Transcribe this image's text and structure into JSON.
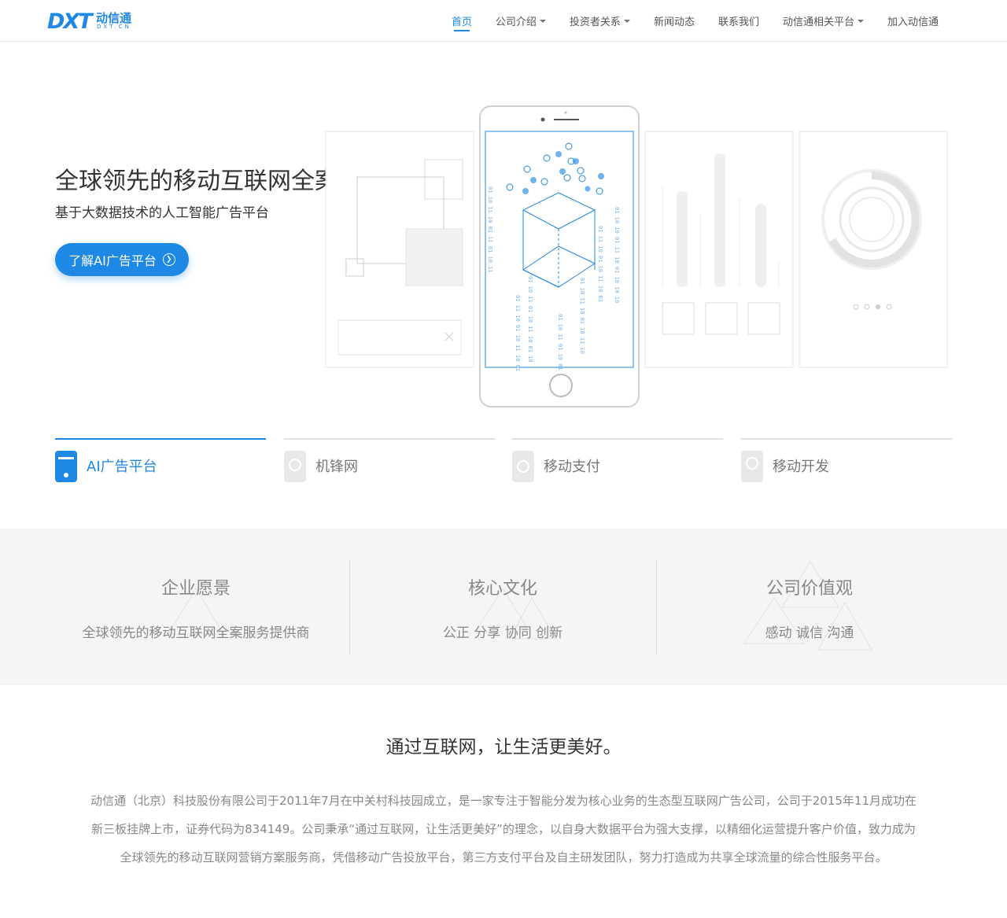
{
  "header": {
    "logo_mark": "DXT",
    "logo_cn": "动信通",
    "logo_sub": "DXT.CN",
    "nav": [
      {
        "label": "首页",
        "active": true,
        "dropdown": false
      },
      {
        "label": "公司介绍",
        "active": false,
        "dropdown": true
      },
      {
        "label": "投资者关系",
        "active": false,
        "dropdown": true
      },
      {
        "label": "新闻动态",
        "active": false,
        "dropdown": false
      },
      {
        "label": "联系我们",
        "active": false,
        "dropdown": false
      },
      {
        "label": "动信通相关平台",
        "active": false,
        "dropdown": true
      },
      {
        "label": "加入动信通",
        "active": false,
        "dropdown": false
      }
    ]
  },
  "hero": {
    "title": "全球领先的移动互联网全案服务商",
    "subtitle": "基于大数据技术的人工智能广告平台",
    "button": "了解AI广告平台"
  },
  "tabs": [
    {
      "label": "AI广告平台",
      "active": true,
      "icon": "ad-platform-icon"
    },
    {
      "label": "机锋网",
      "active": false,
      "icon": "jifeng-icon"
    },
    {
      "label": "移动支付",
      "active": false,
      "icon": "payment-icon"
    },
    {
      "label": "移动开发",
      "active": false,
      "icon": "dev-icon"
    }
  ],
  "values": [
    {
      "title": "企业愿景",
      "desc": "全球领先的移动互联网全案服务提供商"
    },
    {
      "title": "核心文化",
      "desc": "公正  分享  协同  创新"
    },
    {
      "title": "公司价值观",
      "desc": "感动  诚信  沟通"
    }
  ],
  "about": {
    "title": "通过互联网，让生活更美好。",
    "text": "动信通（北京）科技股份有限公司于2011年7月在中关村科技园成立，是一家专注于智能分发为核心业务的生态型互联网广告公司，公司于2015年11月成功在新三板挂牌上市，证券代码为834149。公司秉承“通过互联网，让生活更美好”的理念，以自身大数据平台为强大支撑，以精细化运营提升客户价值，致力成为全球领先的移动互联网营销方案服务商，凭借移动广告投放平台，第三方支付平台及自主研发团队，努力打造成为共享全球流量的综合性服务平台。"
  },
  "colors": {
    "accent": "#1e88e5",
    "band": "#f5f5f5",
    "muted": "#888888"
  }
}
